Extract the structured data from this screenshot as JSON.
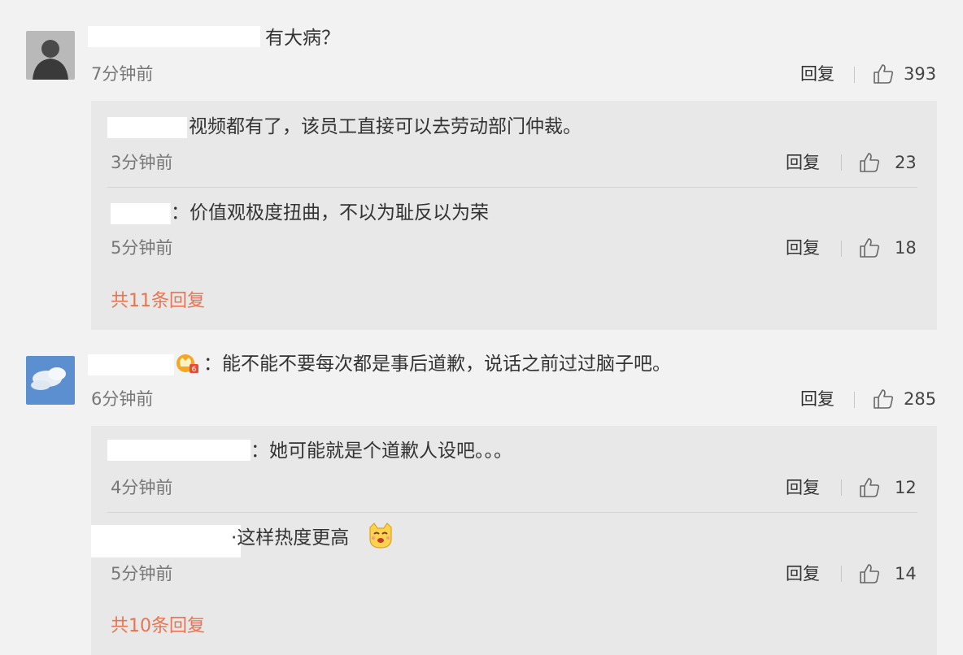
{
  "comments": [
    {
      "text": "有大病？",
      "time": "7分钟前",
      "reply_label": "回复",
      "likes": "393",
      "replies": [
        {
          "text": "视频都有了，该员工直接可以去劳动部门仲裁。",
          "time": "3分钟前",
          "reply_label": "回复",
          "likes": "23"
        },
        {
          "text": "：价值观极度扭曲，不以为耻反以为荣",
          "time": "5分钟前",
          "reply_label": "回复",
          "likes": "18"
        }
      ],
      "more_replies": "共11条回复"
    },
    {
      "text": "：能不能不要每次都是事后道歉，说话之前过过脑子吧。",
      "time": "6分钟前",
      "reply_label": "回复",
      "likes": "285",
      "replies": [
        {
          "text": "：她可能就是个道歉人设吧。。。",
          "time": "4分钟前",
          "reply_label": "回复",
          "likes": "12"
        },
        {
          "text": "·这样热度更高",
          "time": "5分钟前",
          "reply_label": "回复",
          "likes": "14"
        }
      ],
      "more_replies": "共10条回复"
    }
  ],
  "colors": {
    "background": "#f2f2f2",
    "reply_box": "#e8e8e8",
    "link_orange": "#eb7350",
    "time_gray": "#777777"
  },
  "icons": {
    "like": "thumbs-up-icon",
    "vip_badge": "vip-badge-icon",
    "emoji": "smirk-emoji-icon"
  }
}
